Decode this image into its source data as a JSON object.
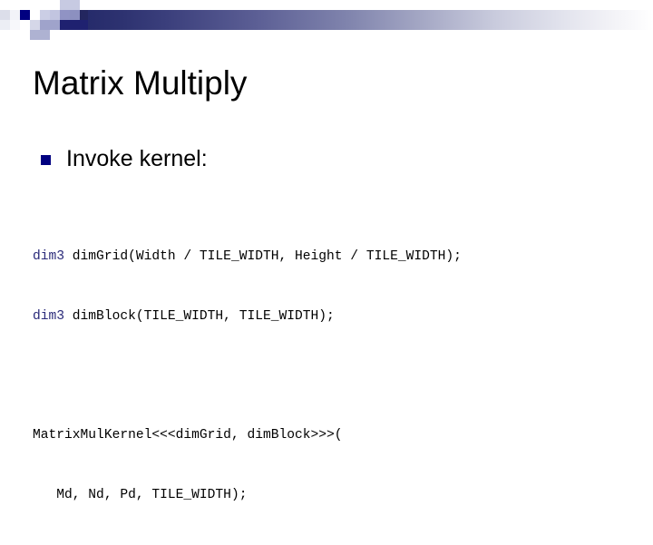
{
  "slide": {
    "title": "Matrix Multiply",
    "background_color": "#ffffff",
    "header": {
      "gradient_from": "#262b6b",
      "gradient_to": "#ffffff",
      "accent_navy": "#000080",
      "accent_light": "#c9cbe4",
      "accent_mid": "#9a9ec8",
      "accent_dark": "#1f2170"
    },
    "bullets": [
      {
        "marker": "square-bullet",
        "text": "Invoke kernel:"
      }
    ],
    "code_blocks": [
      {
        "lines": [
          {
            "keyword": "dim3",
            "rest": " dimGrid(Width / TILE_WIDTH, Height / TILE_WIDTH);"
          },
          {
            "keyword": "dim3",
            "rest": " dimBlock(TILE_WIDTH, TILE_WIDTH);"
          }
        ]
      },
      {
        "lines": [
          {
            "keyword": "",
            "rest": "MatrixMulKernel<<<dimGrid, dimBlock>>>("
          },
          {
            "keyword": "",
            "rest": "   Md, Nd, Pd, TILE_WIDTH);"
          }
        ]
      }
    ],
    "code_keyword_color": "#2a2a7a",
    "code_text_color": "#000000"
  }
}
